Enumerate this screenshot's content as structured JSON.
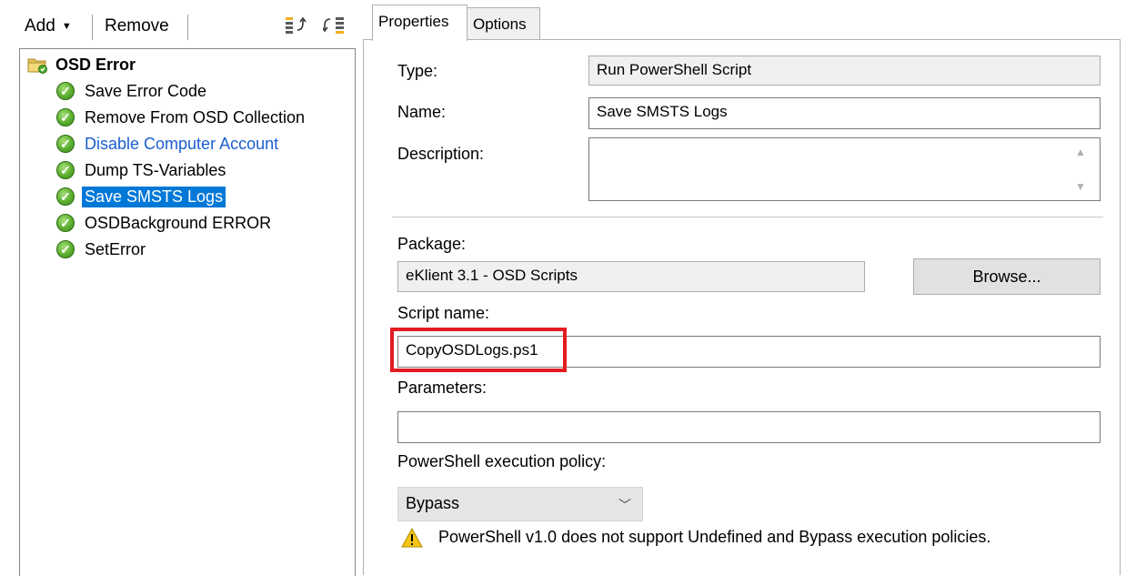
{
  "toolbar": {
    "add_label": "Add",
    "remove_label": "Remove",
    "icon1": "move-up-icon",
    "icon2": "move-down-icon"
  },
  "tree": {
    "root_label": "OSD Error",
    "items": [
      {
        "label": "Save Error Code"
      },
      {
        "label": "Remove From OSD Collection"
      },
      {
        "label": "Disable Computer Account"
      },
      {
        "label": "Dump TS-Variables"
      },
      {
        "label": "Save SMSTS Logs"
      },
      {
        "label": "OSDBackground ERROR"
      },
      {
        "label": "SetError"
      }
    ],
    "selected_index": 4
  },
  "tabs": [
    {
      "label": "Properties"
    },
    {
      "label": "Options"
    }
  ],
  "properties": {
    "type_label": "Type:",
    "type_value": "Run PowerShell Script",
    "name_label": "Name:",
    "name_value": "Save SMSTS Logs",
    "description_label": "Description:",
    "description_value": "",
    "package_label": "Package:",
    "package_value": "eKlient 3.1 - OSD Scripts",
    "browse_label": "Browse...",
    "script_name_label": "Script name:",
    "script_name_value": "CopyOSDLogs.ps1",
    "parameters_label": "Parameters:",
    "parameters_value": "",
    "policy_label": "PowerShell execution policy:",
    "policy_value": "Bypass",
    "warning_text": "PowerShell v1.0 does not support Undefined and Bypass execution policies."
  },
  "colors": {
    "selection": "#0078d7",
    "link": "#1a5fcf",
    "highlight_border": "#e31b23"
  }
}
